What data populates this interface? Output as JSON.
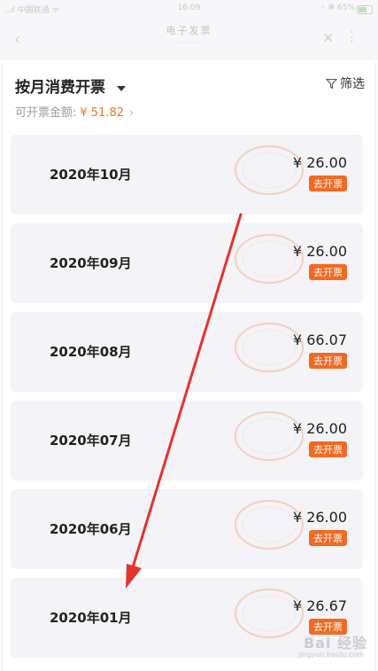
{
  "status_bar": {
    "carrier": "..ıl 中国联通 ᯤ",
    "time": "16:09",
    "battery_text": "◦ ✻ 65%"
  },
  "nav": {
    "title": "电子发票",
    "subtitle": "············",
    "back_icon": "chevron-left-icon",
    "close_icon": "close-icon",
    "more_icon": "more-vertical-icon"
  },
  "header": {
    "title": "按月消费开票",
    "filter_label": "筛选",
    "amount_label": "可开票金额:",
    "amount_value": "¥ 51.82"
  },
  "invoices": [
    {
      "month": "2020年10月",
      "amount": "¥ 26.00",
      "button": "去开票"
    },
    {
      "month": "2020年09月",
      "amount": "¥ 26.00",
      "button": "去开票"
    },
    {
      "month": "2020年08月",
      "amount": "¥ 66.07",
      "button": "去开票"
    },
    {
      "month": "2020年07月",
      "amount": "¥ 26.00",
      "button": "去开票"
    },
    {
      "month": "2020年06月",
      "amount": "¥ 26.00",
      "button": "去开票"
    },
    {
      "month": "2020年01月",
      "amount": "¥ 26.67",
      "button": "去开票"
    }
  ],
  "watermark": {
    "text": "Bai 经验",
    "sub": "jingyan.baidu.com"
  },
  "colors": {
    "accent": "#f26a22",
    "card_bg": "#f3f3f8",
    "arrow": "#e8322c"
  }
}
